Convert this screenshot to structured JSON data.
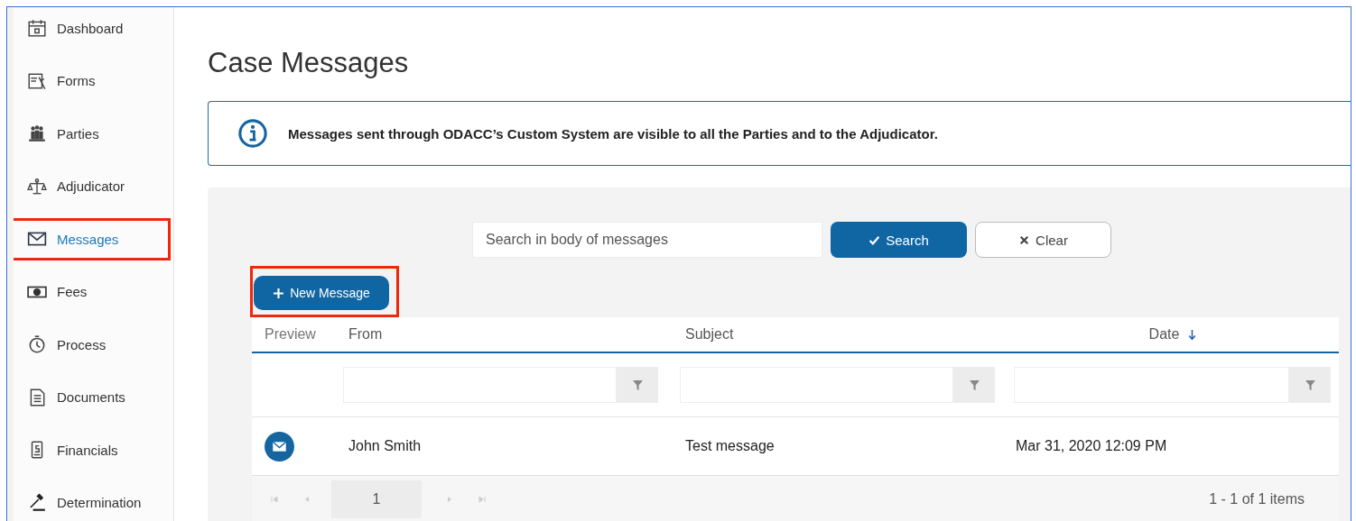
{
  "sidebar": {
    "items": [
      {
        "label": "Dashboard",
        "selected": false,
        "highlighted": false
      },
      {
        "label": "Forms",
        "selected": false,
        "highlighted": false
      },
      {
        "label": "Parties",
        "selected": false,
        "highlighted": false
      },
      {
        "label": "Adjudicator",
        "selected": false,
        "highlighted": false
      },
      {
        "label": "Messages",
        "selected": true,
        "highlighted": true
      },
      {
        "label": "Fees",
        "selected": false,
        "highlighted": false
      },
      {
        "label": "Process",
        "selected": false,
        "highlighted": false
      },
      {
        "label": "Documents",
        "selected": false,
        "highlighted": false
      },
      {
        "label": "Financials",
        "selected": false,
        "highlighted": false
      },
      {
        "label": "Determination",
        "selected": false,
        "highlighted": false
      }
    ]
  },
  "page_title": "Case Messages",
  "info": "Messages sent through ODACC’s Custom System are visible to all the Parties and to the Adjudicator.",
  "search": {
    "placeholder": "Search in body of messages",
    "search_button": "Search",
    "clear_button": "Clear"
  },
  "new_message_button": {
    "label": "New Message",
    "highlighted": true
  },
  "table": {
    "columns": [
      {
        "label": "Preview",
        "filter": false,
        "sorted": false
      },
      {
        "label": "From",
        "filter": true,
        "sorted": false
      },
      {
        "label": "Subject",
        "filter": true,
        "sorted": false
      },
      {
        "label": "Date",
        "filter": true,
        "sorted": true
      }
    ],
    "rows": [
      {
        "from": "John Smith",
        "subject": "Test message",
        "date": "Mar 31, 2020 12:09 PM"
      }
    ],
    "pager": {
      "page": "1",
      "summary": "1 - 1 of 1 items"
    }
  }
}
